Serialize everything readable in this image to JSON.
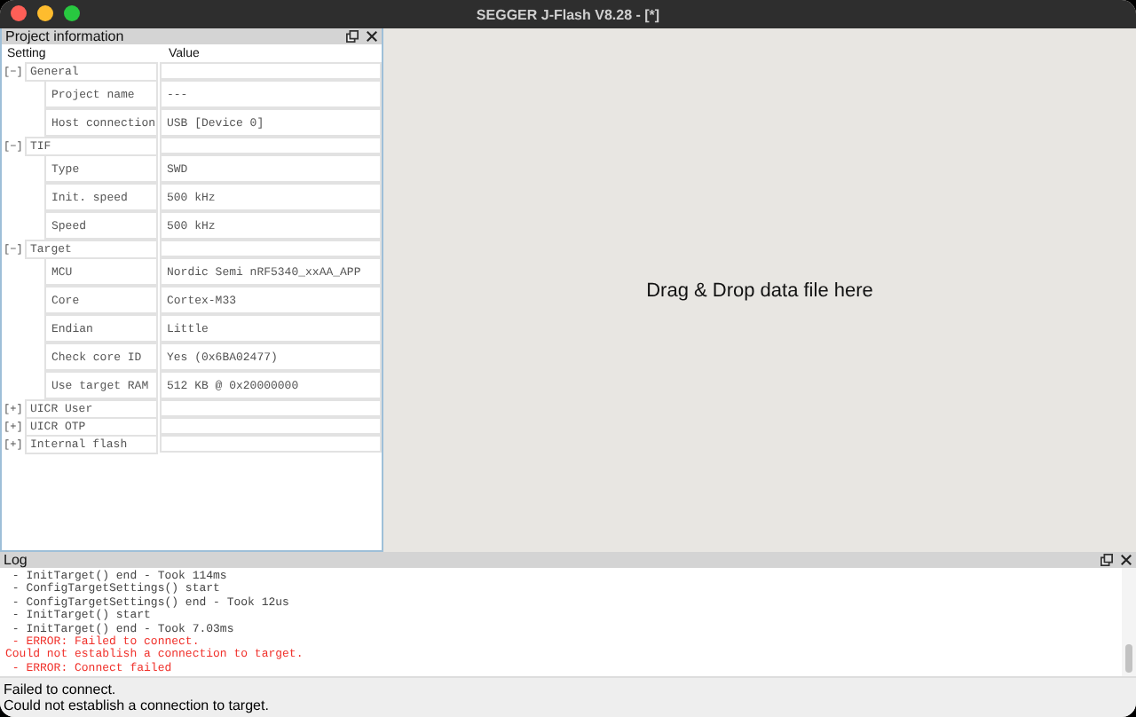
{
  "window": {
    "title": "SEGGER J-Flash V8.28 - [*]"
  },
  "project_panel": {
    "title": "Project information",
    "columns": [
      "Setting",
      "Value"
    ],
    "groups": [
      {
        "toggle": "[−]",
        "name": "General",
        "children": [
          {
            "setting": "Project name",
            "value": "---"
          },
          {
            "setting": "Host connection",
            "value": "USB [Device 0]"
          }
        ]
      },
      {
        "toggle": "[−]",
        "name": "TIF",
        "children": [
          {
            "setting": "Type",
            "value": "SWD"
          },
          {
            "setting": "Init. speed",
            "value": "500 kHz"
          },
          {
            "setting": "Speed",
            "value": "500 kHz"
          }
        ]
      },
      {
        "toggle": "[−]",
        "name": "Target",
        "children": [
          {
            "setting": "MCU",
            "value": "Nordic Semi nRF5340_xxAA_APP"
          },
          {
            "setting": "Core",
            "value": "Cortex-M33"
          },
          {
            "setting": "Endian",
            "value": "Little"
          },
          {
            "setting": "Check core ID",
            "value": "Yes (0x6BA02477)"
          },
          {
            "setting": "Use target RAM",
            "value": "512 KB @ 0x20000000"
          }
        ]
      },
      {
        "toggle": "[+]",
        "name": "UICR User"
      },
      {
        "toggle": "[+]",
        "name": "UICR OTP"
      },
      {
        "toggle": "[+]",
        "name": "Internal flash"
      }
    ]
  },
  "drop_area": {
    "text": "Drag & Drop data file here"
  },
  "log": {
    "title": "Log",
    "lines": [
      {
        "text": " - InitTarget() end - Took 114ms",
        "kind": "info"
      },
      {
        "text": " - ConfigTargetSettings() start",
        "kind": "info"
      },
      {
        "text": " - ConfigTargetSettings() end - Took 12us",
        "kind": "info"
      },
      {
        "text": " - InitTarget() start",
        "kind": "info"
      },
      {
        "text": " - InitTarget() end - Took 7.03ms",
        "kind": "info"
      },
      {
        "text": " - ERROR: Failed to connect.",
        "kind": "error"
      },
      {
        "text": "Could not establish a connection to target.",
        "kind": "error"
      },
      {
        "text": " - ERROR: Connect failed",
        "kind": "error"
      }
    ]
  },
  "status_bar": {
    "lines": [
      "Failed to connect.",
      "Could not establish a connection to target."
    ]
  }
}
